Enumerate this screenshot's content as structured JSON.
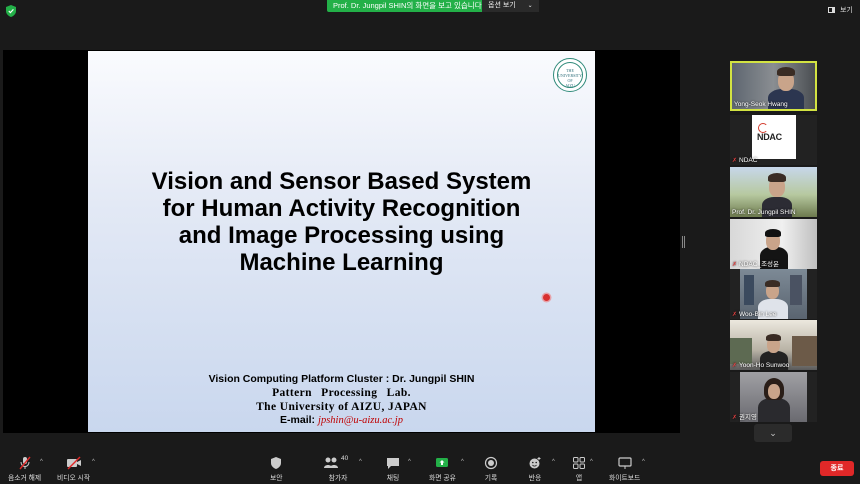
{
  "topbar": {
    "share_banner": "Prof. Dr. Jungpil SHIN의 화면을 보고 있습니다",
    "view_options": "옵션 보기",
    "view_button": "보기"
  },
  "slide": {
    "title_lines": [
      "Vision and Sensor Based System",
      "for Human Activity Recognition",
      "and Image Processing using",
      "Machine Learning"
    ],
    "logo_text": "THE UNIVERSITY OF AIZU",
    "cluster": "Vision Computing Platform Cluster : Dr. Jungpil SHIN",
    "lab": "Pattern Processing Lab.",
    "university": "The University of AIZU, JAPAN",
    "email_label": "E-mail:",
    "email_address": "jpshin@u-aizu.ac.jp"
  },
  "participants": [
    {
      "name": "Yong-Seok Hwang",
      "muted": false
    },
    {
      "name": "NDAC",
      "muted": true,
      "logo_text": "NDAC"
    },
    {
      "name": "Prof. Dr. Jungpil SHIN",
      "muted": false
    },
    {
      "name": "NDAC_조성윤",
      "muted": true
    },
    {
      "name": "Woo-Bin Lee",
      "muted": true
    },
    {
      "name": "Yoon-Ho Sunwoo",
      "muted": true
    },
    {
      "name": "권지영",
      "muted": true
    }
  ],
  "toolbar": {
    "mute": "음소거 해제",
    "video": "비디오 시작",
    "security": "보안",
    "participants": "참가자",
    "participants_count": "40",
    "chat": "채팅",
    "share": "화면 공유",
    "record": "기록",
    "reactions": "반응",
    "apps": "앱",
    "whiteboard": "화이트보드",
    "end": "종료"
  },
  "colors": {
    "share_green": "#23b048",
    "active_speaker_border": "#d3e342",
    "end_red": "#e02828"
  }
}
